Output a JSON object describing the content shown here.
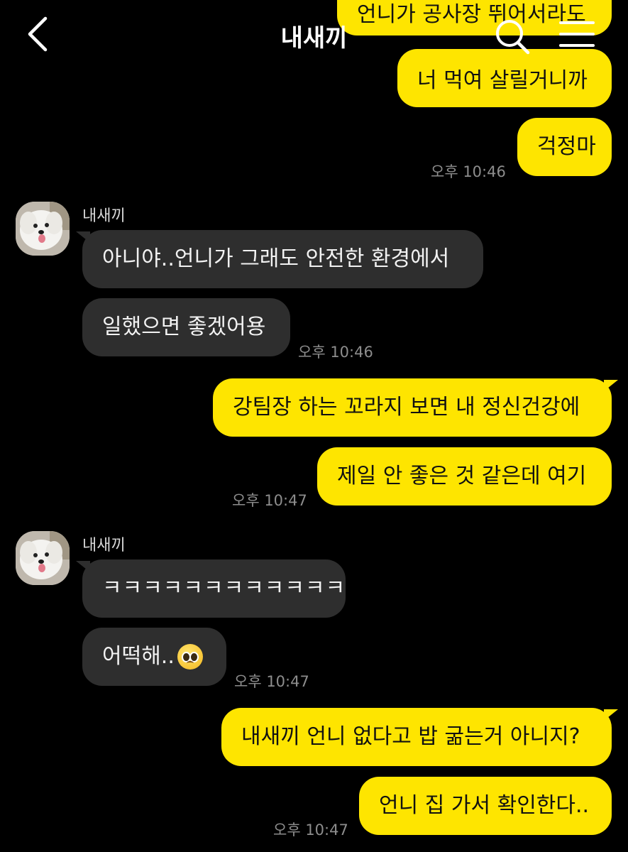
{
  "header": {
    "title": "내새끼",
    "back_icon": "chevron-left-icon",
    "search_icon": "search-icon",
    "menu_icon": "hamburger-menu-icon"
  },
  "colors": {
    "my_bubble": "#FEE500",
    "their_bubble": "#2e2e2e",
    "background": "#000000"
  },
  "messages": {
    "m0": "언니가 공사장 뛰어서라도",
    "m1": "너 먹여 살릴거니까",
    "m2": "걱정마",
    "t1": "오후 10:46",
    "s1": "내새끼",
    "m3": "아니야..언니가 그래도 안전한 환경에서",
    "m4": "일했으면 좋겠어용",
    "t2": "오후 10:46",
    "m5": "강팀장 하는 꼬라지 보면 내 정신건강에",
    "m6": "제일 안 좋은 것 같은데 여기",
    "t3": "오후 10:47",
    "s2": "내새끼",
    "m7": "ㅋㅋㅋㅋㅋㅋㅋㅋㅋㅋㅋㅋ",
    "m8": "어떡해..",
    "m8_emoji": "pleading-face-emoji",
    "t4": "오후 10:47",
    "m9": "내새끼 언니 없다고 밥 굶는거 아니지?",
    "m10": "언니 집 가서 확인한다..",
    "t5": "오후 10:47"
  }
}
